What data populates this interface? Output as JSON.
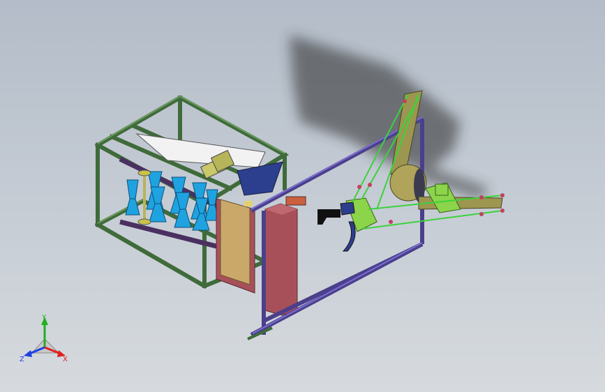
{
  "viewport": {
    "name": "cad-3d-viewport",
    "background_top": "#b3bcc8",
    "background_bottom": "#d6dade"
  },
  "model": {
    "frame_color": "#3f6b3a",
    "rail_color": "#4b3f8c",
    "roller_color": "#1fa3e0",
    "panel_front_color": "#c9a86a",
    "panel_side_color": "#a8505a",
    "arm_color": "#9c9650",
    "gripper_color": "#8cd44a",
    "cable_color": "#3cd23c"
  },
  "triad": {
    "x_label": "X",
    "y_label": "Y",
    "z_label": "Z",
    "x_color": "#e02020",
    "y_color": "#20b020",
    "z_color": "#2040e0"
  }
}
